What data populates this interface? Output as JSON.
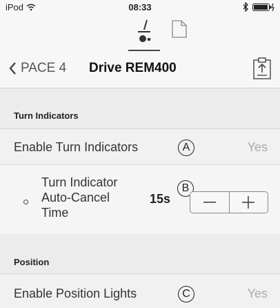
{
  "status_bar": {
    "device": "iPod",
    "time": "08:33"
  },
  "nav": {
    "back_label": "PACE 4",
    "title": "Drive REM400"
  },
  "sections": {
    "turn_indicators": {
      "header": "Turn Indicators",
      "enable_label": "Enable Turn Indicators",
      "enable_callout": "A",
      "enable_value": "Yes",
      "auto_cancel_label_line1": "Turn Indicator",
      "auto_cancel_label_line2": "Auto-Cancel",
      "auto_cancel_label_line3": "Time",
      "auto_cancel_value": "15s",
      "auto_cancel_callout": "B"
    },
    "position": {
      "header": "Position",
      "enable_label": "Enable Position Lights",
      "enable_callout": "C",
      "enable_value": "Yes"
    }
  },
  "icons": {
    "wifi": "wifi-icon",
    "bluetooth": "bluetooth-icon",
    "battery": "battery-icon",
    "drive_tab": "wheelchair-drive-icon",
    "document_tab": "document-icon",
    "back": "chevron-left-icon",
    "clipboard": "clipboard-upload-icon"
  },
  "colors": {
    "background": "#f1f1f1",
    "section_header": "#ececec",
    "value_gray": "#aaaaaa"
  }
}
